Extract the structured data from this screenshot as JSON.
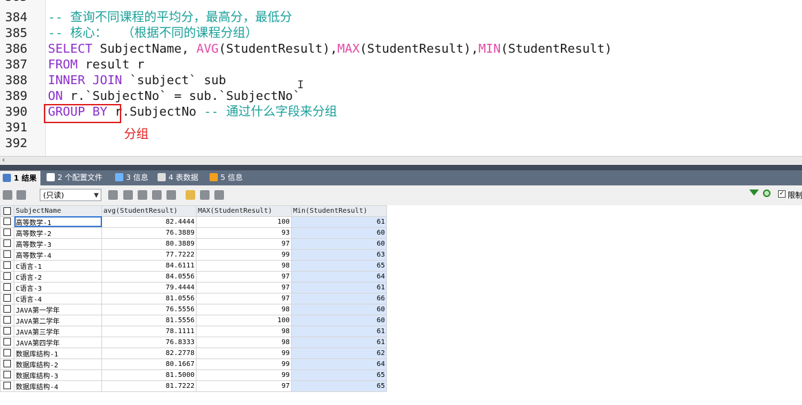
{
  "editor": {
    "top_cut_line_number": "383",
    "lines": [
      {
        "no": "384",
        "tokens": [
          {
            "t": "-- 查询不同课程的平均分，最高分，最低分",
            "c": "cm"
          }
        ]
      },
      {
        "no": "385",
        "tokens": [
          {
            "t": "-- 核心：  （根据不同的课程分组）",
            "c": "cm"
          }
        ]
      },
      {
        "no": "386",
        "tokens": [
          {
            "t": "SELECT",
            "c": "kw"
          },
          {
            "t": " SubjectName, ",
            "c": "tx"
          },
          {
            "t": "AVG",
            "c": "fn"
          },
          {
            "t": "(StudentResult),",
            "c": "tx"
          },
          {
            "t": "MAX",
            "c": "fn"
          },
          {
            "t": "(StudentResult),",
            "c": "tx"
          },
          {
            "t": "MIN",
            "c": "fn"
          },
          {
            "t": "(StudentResult)",
            "c": "tx"
          }
        ]
      },
      {
        "no": "387",
        "tokens": [
          {
            "t": "FROM",
            "c": "kw"
          },
          {
            "t": " result r",
            "c": "tx"
          }
        ]
      },
      {
        "no": "388",
        "tokens": [
          {
            "t": "INNER JOIN",
            "c": "kw"
          },
          {
            "t": " `subject` sub",
            "c": "tx"
          }
        ]
      },
      {
        "no": "389",
        "tokens": [
          {
            "t": "ON",
            "c": "kw"
          },
          {
            "t": " r.`SubjectNo` = sub.`SubjectNo`",
            "c": "tx"
          }
        ]
      },
      {
        "no": "390",
        "tokens": [
          {
            "t": "GROUP BY",
            "c": "kw"
          },
          {
            "t": " r.SubjectNo ",
            "c": "tx"
          },
          {
            "t": "-- 通过什么字段来分组",
            "c": "cm"
          }
        ]
      },
      {
        "no": "391",
        "tokens": []
      },
      {
        "no": "392",
        "tokens": []
      }
    ],
    "annotation": "分组",
    "cursor_glyph": "I"
  },
  "tabs": [
    {
      "label": "1 结果",
      "icon": "grid-result-icon",
      "active": true
    },
    {
      "label": "2 个配置文件",
      "icon": "profile-icon",
      "active": false
    },
    {
      "label": "3 信息",
      "icon": "info-icon",
      "active": false
    },
    {
      "label": "4 表数据",
      "icon": "table-data-icon",
      "active": false
    },
    {
      "label": "5 信息",
      "icon": "info-icon",
      "active": false
    }
  ],
  "toolbar": {
    "readonly_value": "(只读)",
    "limit_label": "限制"
  },
  "grid": {
    "columns": [
      "SubjectName",
      "avg(StudentResult)",
      "MAX(StudentResult)",
      "Min(StudentResult)"
    ],
    "rows": [
      [
        "高等数学-1",
        "82.4444",
        "100",
        "61"
      ],
      [
        "高等数学-2",
        "76.3889",
        "93",
        "60"
      ],
      [
        "高等数学-3",
        "80.3889",
        "97",
        "60"
      ],
      [
        "高等数学-4",
        "77.7222",
        "99",
        "63"
      ],
      [
        "C语言-1",
        "84.6111",
        "98",
        "65"
      ],
      [
        "C语言-2",
        "84.0556",
        "97",
        "64"
      ],
      [
        "C语言-3",
        "79.4444",
        "97",
        "61"
      ],
      [
        "C语言-4",
        "81.0556",
        "97",
        "66"
      ],
      [
        "JAVA第一学年",
        "76.5556",
        "98",
        "60"
      ],
      [
        "JAVA第二学年",
        "81.5556",
        "100",
        "60"
      ],
      [
        "JAVA第三学年",
        "78.1111",
        "98",
        "61"
      ],
      [
        "JAVA第四学年",
        "76.8333",
        "98",
        "61"
      ],
      [
        "数据库结构-1",
        "82.2778",
        "99",
        "62"
      ],
      [
        "数据库结构-2",
        "80.1667",
        "99",
        "64"
      ],
      [
        "数据库结构-3",
        "81.5000",
        "99",
        "65"
      ],
      [
        "数据库结构-4",
        "81.7222",
        "97",
        "65"
      ]
    ]
  }
}
